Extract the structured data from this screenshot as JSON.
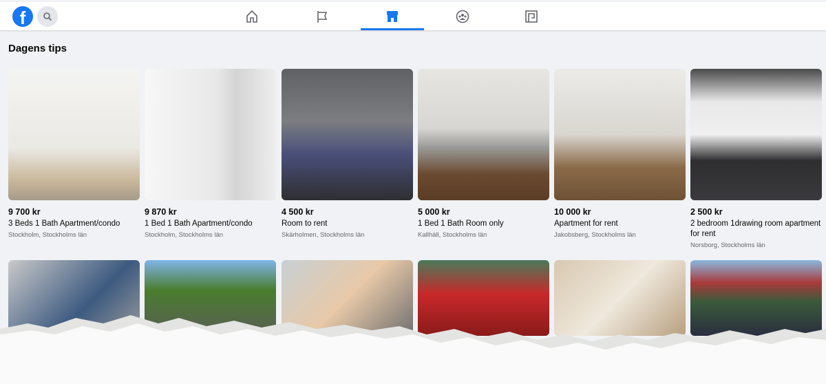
{
  "nav": {
    "tabs": [
      {
        "name": "home",
        "active": false
      },
      {
        "name": "pages",
        "active": false
      },
      {
        "name": "marketplace",
        "active": true
      },
      {
        "name": "groups",
        "active": false
      },
      {
        "name": "gaming",
        "active": false
      }
    ],
    "accent": "#1877f2"
  },
  "section": {
    "title": "Dagens tips"
  },
  "listings": [
    {
      "price": "9 700 kr",
      "title": "3 Beds 1 Bath Apartment/condo",
      "location": "Stockholm, Stockholms län"
    },
    {
      "price": "9 870 kr",
      "title": "1 Bed 1 Bath Apartment/condo",
      "location": "Stockholm, Stockholms län"
    },
    {
      "price": "4 500 kr",
      "title": "Room to rent",
      "location": "Skärholmen, Stockholms län"
    },
    {
      "price": "5 000 kr",
      "title": "1 Bed 1 Bath Room only",
      "location": "Kallhäll, Stockholms län"
    },
    {
      "price": "10 000 kr",
      "title": "Apartment for rent",
      "location": "Jakobsberg, Stockholms län"
    },
    {
      "price": "2 500 kr",
      "title": "2 bedroom 1drawing room apartment for rent",
      "location": "Norsborg, Stockholms län"
    }
  ]
}
